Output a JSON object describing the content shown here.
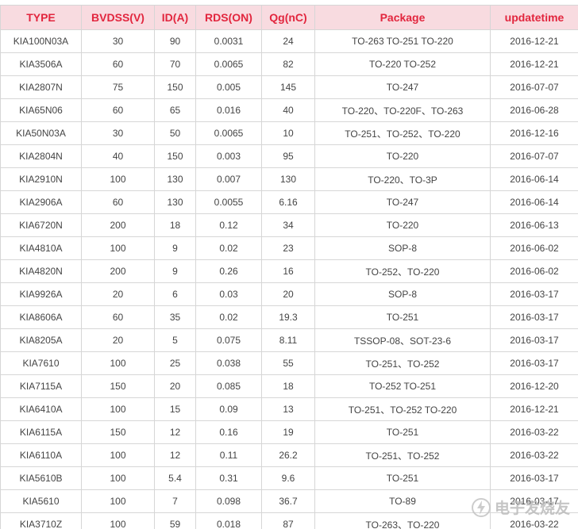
{
  "table": {
    "headers": [
      "TYPE",
      "BVDSS(V)",
      "ID(A)",
      "RDS(ON)",
      "Qg(nC)",
      "Package",
      "updatetime"
    ],
    "rows": [
      [
        "KIA100N03A",
        "30",
        "90",
        "0.0031",
        "24",
        "TO-263 TO-251 TO-220",
        "2016-12-21"
      ],
      [
        "KIA3506A",
        "60",
        "70",
        "0.0065",
        "82",
        "TO-220 TO-252",
        "2016-12-21"
      ],
      [
        "KIA2807N",
        "75",
        "150",
        "0.005",
        "145",
        "TO-247",
        "2016-07-07"
      ],
      [
        "KIA65N06",
        "60",
        "65",
        "0.016",
        "40",
        "TO-220、TO-220F、TO-263",
        "2016-06-28"
      ],
      [
        "KIA50N03A",
        "30",
        "50",
        "0.0065",
        "10",
        "TO-251、TO-252、TO-220",
        "2016-12-16"
      ],
      [
        "KIA2804N",
        "40",
        "150",
        "0.003",
        "95",
        "TO-220",
        "2016-07-07"
      ],
      [
        "KIA2910N",
        "100",
        "130",
        "0.007",
        "130",
        "TO-220、TO-3P",
        "2016-06-14"
      ],
      [
        "KIA2906A",
        "60",
        "130",
        "0.0055",
        "6.16",
        "TO-247",
        "2016-06-14"
      ],
      [
        "KIA6720N",
        "200",
        "18",
        "0.12",
        "34",
        "TO-220",
        "2016-06-13"
      ],
      [
        "KIA4810A",
        "100",
        "9",
        "0.02",
        "23",
        "SOP-8",
        "2016-06-02"
      ],
      [
        "KIA4820N",
        "200",
        "9",
        "0.26",
        "16",
        "TO-252、TO-220",
        "2016-06-02"
      ],
      [
        "KIA9926A",
        "20",
        "6",
        "0.03",
        "20",
        "SOP-8",
        "2016-03-17"
      ],
      [
        "KIA8606A",
        "60",
        "35",
        "0.02",
        "19.3",
        "TO-251",
        "2016-03-17"
      ],
      [
        "KIA8205A",
        "20",
        "5",
        "0.075",
        "8.11",
        "TSSOP-08、SOT-23-6",
        "2016-03-17"
      ],
      [
        "KIA7610",
        "100",
        "25",
        "0.038",
        "55",
        "TO-251、TO-252",
        "2016-03-17"
      ],
      [
        "KIA7115A",
        "150",
        "20",
        "0.085",
        "18",
        "TO-252 TO-251",
        "2016-12-20"
      ],
      [
        "KIA6410A",
        "100",
        "15",
        "0.09",
        "13",
        "TO-251、TO-252 TO-220",
        "2016-12-21"
      ],
      [
        "KIA6115A",
        "150",
        "12",
        "0.16",
        "19",
        "TO-251",
        "2016-03-22"
      ],
      [
        "KIA6110A",
        "100",
        "12",
        "0.11",
        "26.2",
        "TO-251、TO-252",
        "2016-03-22"
      ],
      [
        "KIA5610B",
        "100",
        "5.4",
        "0.31",
        "9.6",
        "TO-251",
        "2016-03-17"
      ],
      [
        "KIA5610",
        "100",
        "7",
        "0.098",
        "36.7",
        "TO-89",
        "2016-03-17"
      ],
      [
        "KIA3710Z",
        "100",
        "59",
        "0.018",
        "87",
        "TO-263、TO-220",
        "2016-03-22"
      ]
    ]
  },
  "watermark": {
    "text": "电子发烧友",
    "icon": "lightning-logo-icon"
  },
  "colors": {
    "header_bg": "#f8dbe0",
    "header_text": "#e2263e",
    "cell_text": "#444444",
    "border": "#d6d6d6"
  }
}
